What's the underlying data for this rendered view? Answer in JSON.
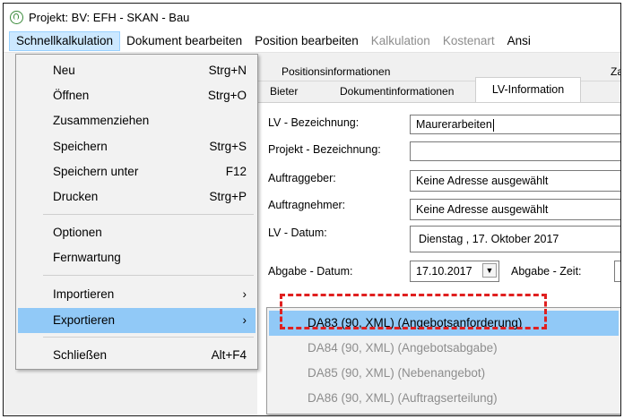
{
  "window": {
    "title": "Projekt: BV: EFH  -  SKAN - Bau"
  },
  "menubar": [
    {
      "label": "Schnellkalkulation",
      "state": "active"
    },
    {
      "label": "Dokument bearbeiten",
      "state": "normal"
    },
    {
      "label": "Position bearbeiten",
      "state": "normal"
    },
    {
      "label": "Kalkulation",
      "state": "disabled"
    },
    {
      "label": "Kostenart",
      "state": "disabled"
    },
    {
      "label": "Ansi",
      "state": "normal"
    }
  ],
  "file_menu": {
    "items": [
      {
        "label": "Neu",
        "shortcut": "Strg+N"
      },
      {
        "label": "Öffnen",
        "shortcut": "Strg+O"
      },
      {
        "label": "Zusammenziehen",
        "shortcut": ""
      },
      {
        "label": "Speichern",
        "shortcut": "Strg+S"
      },
      {
        "label": "Speichern unter",
        "shortcut": "F12"
      },
      {
        "label": "Drucken",
        "shortcut": "Strg+P"
      },
      {
        "label": "Optionen",
        "shortcut": ""
      },
      {
        "label": "Fernwartung",
        "shortcut": ""
      },
      {
        "label": "Importieren",
        "shortcut": "›"
      },
      {
        "label": "Exportieren",
        "shortcut": "›"
      },
      {
        "label": "Schließen",
        "shortcut": "Alt+F4"
      }
    ]
  },
  "export_submenu": {
    "items": [
      {
        "label": "DA83 (90, XML) (Angebotsanforderung)",
        "enabled": true
      },
      {
        "label": "DA84 (90, XML) (Angebotsabgabe)",
        "enabled": false
      },
      {
        "label": "DA85 (90, XML) (Nebenangebot)",
        "enabled": false
      },
      {
        "label": "DA86 (90, XML) (Auftragserteilung)",
        "enabled": false
      }
    ]
  },
  "tabs": {
    "row1": [
      "Positionsinformationen",
      "Za"
    ],
    "row2": [
      "Bieter",
      "Dokumentinformationen",
      "LV-Information"
    ]
  },
  "form": {
    "lv_bezeichnung": {
      "label": "LV - Bezeichnung:",
      "value": "Maurerarbeiten"
    },
    "projekt_bezeichnung": {
      "label": "Projekt - Bezeichnung:",
      "value": ""
    },
    "auftraggeber": {
      "label": "Auftraggeber:",
      "value": "Keine Adresse ausgewählt"
    },
    "auftragnehmer": {
      "label": "Auftragnehmer:",
      "value": "Keine Adresse ausgewählt"
    },
    "lv_datum": {
      "label": "LV - Datum:",
      "value": "Dienstag  ,  17.   Oktober   2017"
    },
    "abgabe_datum": {
      "label": "Abgabe - Datum:",
      "value": "17.10.2017"
    },
    "abgabe_zeit": {
      "label": "Abgabe - Zeit:",
      "value": ""
    }
  },
  "colors": {
    "menu_highlight": "#91c9f7",
    "annotation": "#e02020"
  }
}
